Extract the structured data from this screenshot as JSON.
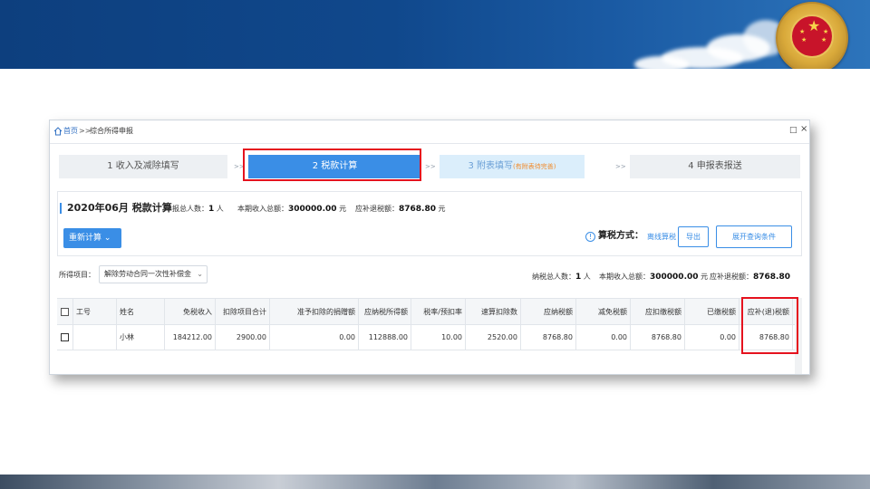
{
  "window": {
    "breadcrumb": {
      "home": "首页",
      "separator": ">>",
      "current": "综合所得申报"
    },
    "restore_glyph": "□",
    "close_glyph": "×"
  },
  "steps": [
    {
      "label": "1 收入及减除填写"
    },
    {
      "label": "2 税款计算"
    },
    {
      "label": "3 附表填写",
      "sub": "(有附表待完善)"
    },
    {
      "label": "4 申报表报送"
    }
  ],
  "step_arrow": ">>",
  "summary": {
    "title": "2020年06月 税款计算",
    "declarants_label": "申报总人数：",
    "declarants_value": "1",
    "declarants_unit": " 人",
    "income_label": "本期收入总额：",
    "income_value": "300000.00",
    "income_unit": " 元",
    "refund_label": "应补退税额：",
    "refund_value": "8768.80",
    "refund_unit": " 元",
    "recalc_button": "重新计算",
    "recalc_chevron": "⌄",
    "method_icon": "!",
    "method_label": "算税方式：",
    "method_value": "离线算税",
    "export_button": "导出",
    "expand_button": "展开查询条件"
  },
  "filter": {
    "income_item_label": "所得项目：",
    "income_item_value": "解除劳动合同一次性补偿金",
    "chevron": "⌄",
    "taxpayers_label": "纳税总人数：",
    "taxpayers_value": "1",
    "taxpayers_unit": " 人",
    "income_total_label": "本期收入总额：",
    "income_total_value": "300000.00",
    "income_total_unit": " 元",
    "refund_label": "应补退税额：",
    "refund_value": "8768.80",
    "refund_unit": " 元"
  },
  "table": {
    "headers": [
      "工号",
      "姓名",
      "免税收入",
      "扣除项目合计",
      "准予扣除的捐赠额",
      "应纳税所得额",
      "税率/预扣率",
      "速算扣除数",
      "应纳税额",
      "减免税额",
      "应扣缴税额",
      "已缴税额",
      "应补(退)税额"
    ],
    "rows": [
      [
        "",
        "小林",
        "184212.00",
        "2900.00",
        "0.00",
        "112888.00",
        "10.00",
        "2520.00",
        "8768.80",
        "0.00",
        "8768.80",
        "0.00",
        "8768.80"
      ]
    ]
  },
  "colors": {
    "accent": "#3a8ee6",
    "highlight_box": "#e5121e",
    "banner": "#10488c"
  },
  "icons": [
    "home-icon",
    "national-emblem-icon",
    "info-icon",
    "chevron-down-icon",
    "checkbox-icon"
  ]
}
